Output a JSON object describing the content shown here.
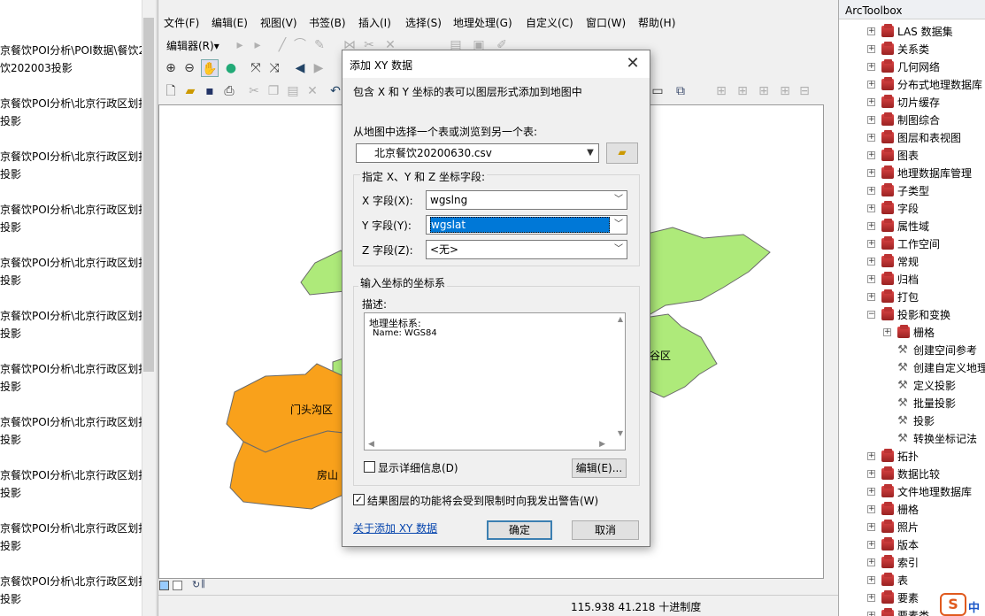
{
  "left_panel": {
    "items": [
      {
        "line1": "京餐饮POI分析\\POI数据\\餐饮2",
        "line2": "饮202003投影"
      },
      {
        "line1": "京餐饮POI分析\\北京行政区划担",
        "line2": "投影"
      },
      {
        "line1": "京餐饮POI分析\\北京行政区划担",
        "line2": "投影"
      },
      {
        "line1": "京餐饮POI分析\\北京行政区划担",
        "line2": "投影"
      },
      {
        "line1": "京餐饮POI分析\\北京行政区划担",
        "line2": "投影"
      },
      {
        "line1": "京餐饮POI分析\\北京行政区划担",
        "line2": "投影"
      },
      {
        "line1": "京餐饮POI分析\\北京行政区划担",
        "line2": "投影"
      },
      {
        "line1": "京餐饮POI分析\\北京行政区划担",
        "line2": "投影"
      },
      {
        "line1": "京餐饮POI分析\\北京行政区划担",
        "line2": "投影"
      },
      {
        "line1": "京餐饮POI分析\\北京行政区划担",
        "line2": "投影"
      },
      {
        "line1": "京餐饮POI分析\\北京行政区划担",
        "line2": "投影"
      }
    ]
  },
  "menu": {
    "items": [
      "文件(F)",
      "编辑(E)",
      "视图(V)",
      "书签(B)",
      "插入(I)",
      "选择(S)",
      "地理处理(G)",
      "自定义(C)",
      "窗口(W)",
      "帮助(H)"
    ]
  },
  "editor_toolbar": {
    "label": "编辑器(R)▾"
  },
  "map": {
    "labels": {
      "mentougou": "门头沟区",
      "fangshan": "房山",
      "pinggu": "谷区"
    },
    "colors": {
      "orange": "#F9A11B",
      "green": "#AEEA7A",
      "outline": "#6a6a6a"
    }
  },
  "status_bar": {
    "coords": "115.938  41.218 十进制度"
  },
  "toolbox": {
    "title": "ArcToolbox",
    "items": [
      "LAS 数据集",
      "关系类",
      "几何网络",
      "分布式地理数据库",
      "切片缓存",
      "制图综合",
      "图层和表视图",
      "图表",
      "地理数据库管理",
      "子类型",
      "字段",
      "属性域",
      "工作空间",
      "常规",
      "归档",
      "打包",
      "投影和变换"
    ],
    "sub_items": [
      "栅格",
      "创建空间参考",
      "创建自定义地理",
      "定义投影",
      "批量投影",
      "投影",
      "转换坐标记法"
    ],
    "items_after": [
      "拓扑",
      "数据比较",
      "文件地理数据库",
      "栅格",
      "照片",
      "版本",
      "索引",
      "表",
      "要素",
      "要素类"
    ]
  },
  "dialog": {
    "title": "添加 XY 数据",
    "description": "包含 X 和 Y 坐标的表可以图层形式添加到地图中",
    "choose_table_label": "从地图中选择一个表或浏览到另一个表:",
    "table_value": "北京餐饮20200630.csv",
    "fields_group_label": "指定 X、Y 和 Z 坐标字段:",
    "x_label": "X 字段(X):",
    "x_value": "wgslng",
    "y_label": "Y 字段(Y):",
    "y_value": "wgslat",
    "z_label": "Z 字段(Z):",
    "z_value": "<无>",
    "crs_group_label": "输入坐标的坐标系",
    "desc_label": "描述:",
    "crs_line1": "地理坐标系:",
    "crs_line2": "Name: WGS84",
    "show_details_label": "显示详细信息(D)",
    "edit_button": "编辑(E)...",
    "warn_label": "结果图层的功能将会受到限制时向我发出警告(W)",
    "about_link": "关于添加 XY 数据",
    "ok_button": "确定",
    "cancel_button": "取消"
  },
  "watermark": {
    "text": "中"
  }
}
